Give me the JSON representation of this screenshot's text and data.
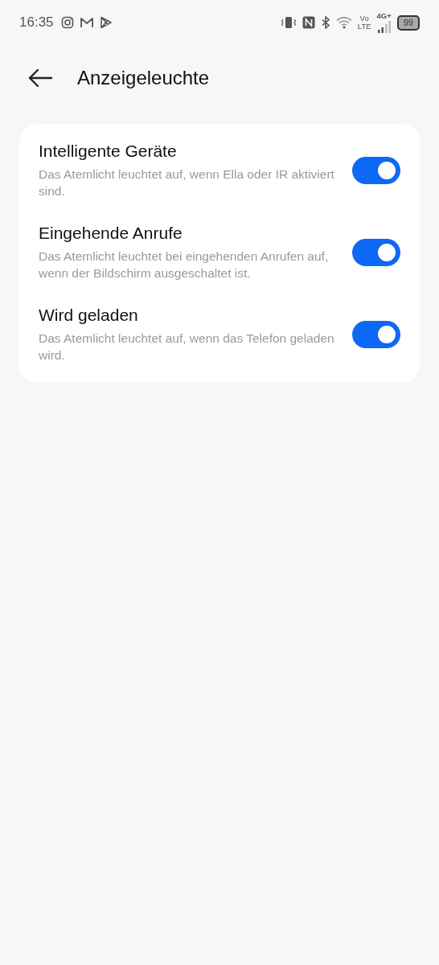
{
  "status_bar": {
    "time": "16:35",
    "volte_top": "Vo",
    "volte_bottom": "LTE",
    "network": "4G+",
    "battery": "99"
  },
  "header": {
    "title": "Anzeigeleuchte"
  },
  "settings": [
    {
      "title": "Intelligente Geräte",
      "description": "Das Atemlicht leuchtet auf, wenn Ella oder IR aktiviert sind.",
      "on": true
    },
    {
      "title": "Eingehende Anrufe",
      "description": "Das Atemlicht leuchtet bei eingehenden Anrufen auf, wenn der Bildschirm ausgeschaltet ist.",
      "on": true
    },
    {
      "title": "Wird geladen",
      "description": "Das Atemlicht leuchtet auf, wenn das Telefon geladen wird.",
      "on": true
    }
  ]
}
